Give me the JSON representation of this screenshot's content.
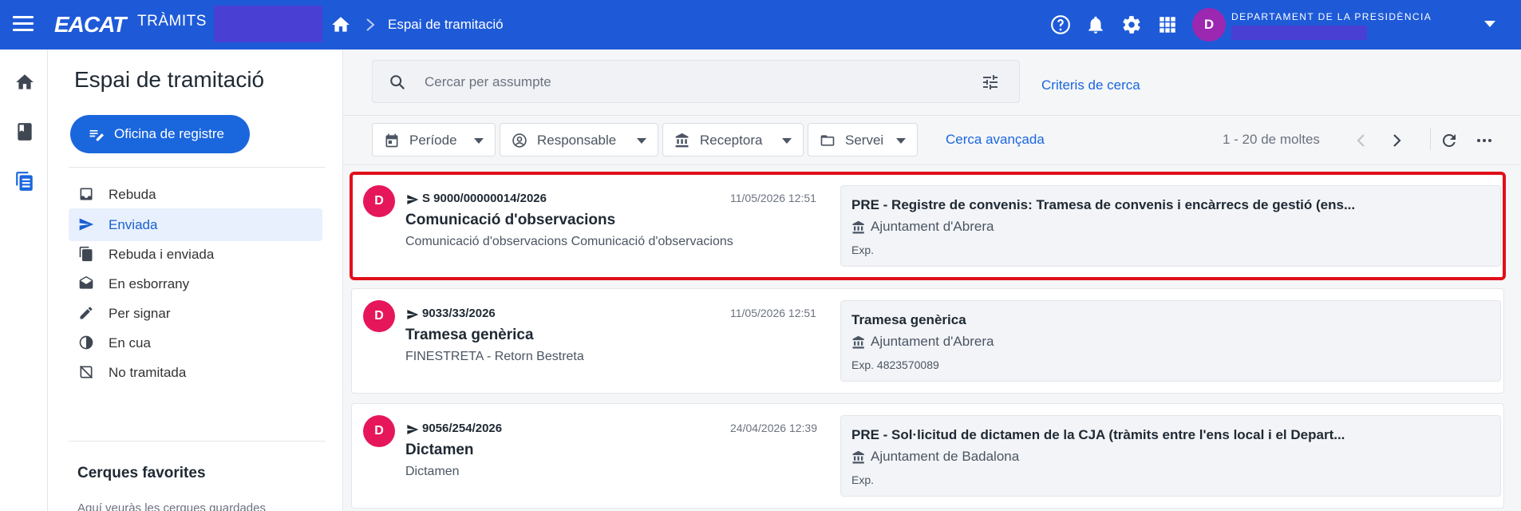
{
  "app": {
    "logo": "EACAT",
    "logo_sub": "TRÀMITS",
    "breadcrumb_title": "Espai de tramitació",
    "department": "DEPARTAMENT DE LA PRESIDÈNCIA",
    "user_initial": "D",
    "icons": [
      "menu-icon",
      "home-icon",
      "chevron-right-icon",
      "help-icon",
      "bell-icon",
      "gear-icon",
      "apps-grid-icon",
      "caret-down-icon"
    ]
  },
  "rail": {
    "icons": [
      "home-icon",
      "book-icon",
      "documents-icon"
    ]
  },
  "sidebar": {
    "title": "Espai de tramitació",
    "office_button": "Oficina de registre",
    "items": [
      {
        "label": "Rebuda",
        "icon": "inbox-icon"
      },
      {
        "label": "Enviada",
        "icon": "send-icon",
        "active": true
      },
      {
        "label": "Rebuda i enviada",
        "icon": "copy-icon"
      },
      {
        "label": "En esborrany",
        "icon": "drafts-icon"
      },
      {
        "label": "Per signar",
        "icon": "sign-icon"
      },
      {
        "label": "En cua",
        "icon": "pending-icon"
      },
      {
        "label": "No tramitada",
        "icon": "unprocessed-icon"
      }
    ],
    "favorites_title": "Cerques favorites",
    "favorites_text": "Aquí veuràs les cerques guardades"
  },
  "search": {
    "placeholder": "Cercar per assumpte",
    "criteria_link": "Criteris de cerca"
  },
  "filters": {
    "buttons": [
      "Període",
      "Responsable",
      "Receptora",
      "Servei"
    ],
    "advanced": "Cerca avançada",
    "pagination": "1 - 20 de moltes"
  },
  "colors": {
    "topbar": "#1e5ad8",
    "accent": "#1a66dd",
    "avatar_top": "#9c27b0",
    "avatar_item": "#e5175a",
    "selection": "#e0101a"
  },
  "items": [
    {
      "avatar": "D",
      "reference": "S 9000/00000014/2026",
      "date": "11/05/2026 12:51",
      "title": "Comunicació d'observacions",
      "subtitle": "Comunicació d'observacions Comunicació d'observacions",
      "procedure": "PRE - Registre de convenis: Tramesa de convenis i encàrrecs de gestió (ens...",
      "organization": "Ajuntament d'Abrera",
      "expedient": "Exp.",
      "selected": true
    },
    {
      "avatar": "D",
      "reference": "9033/33/2026",
      "date": "11/05/2026 12:51",
      "title": "Tramesa genèrica",
      "subtitle": "FINESTRETA - Retorn Bestreta",
      "procedure": "Tramesa genèrica",
      "organization": "Ajuntament d'Abrera",
      "expedient": "Exp. 4823570089",
      "selected": false
    },
    {
      "avatar": "D",
      "reference": "9056/254/2026",
      "date": "24/04/2026 12:39",
      "title": "Dictamen",
      "subtitle": "Dictamen",
      "procedure": "PRE - Sol·licitud de dictamen de la CJA (tràmits entre l'ens local i el Depart...",
      "organization": "Ajuntament de Badalona",
      "expedient": "Exp.",
      "selected": false
    }
  ]
}
